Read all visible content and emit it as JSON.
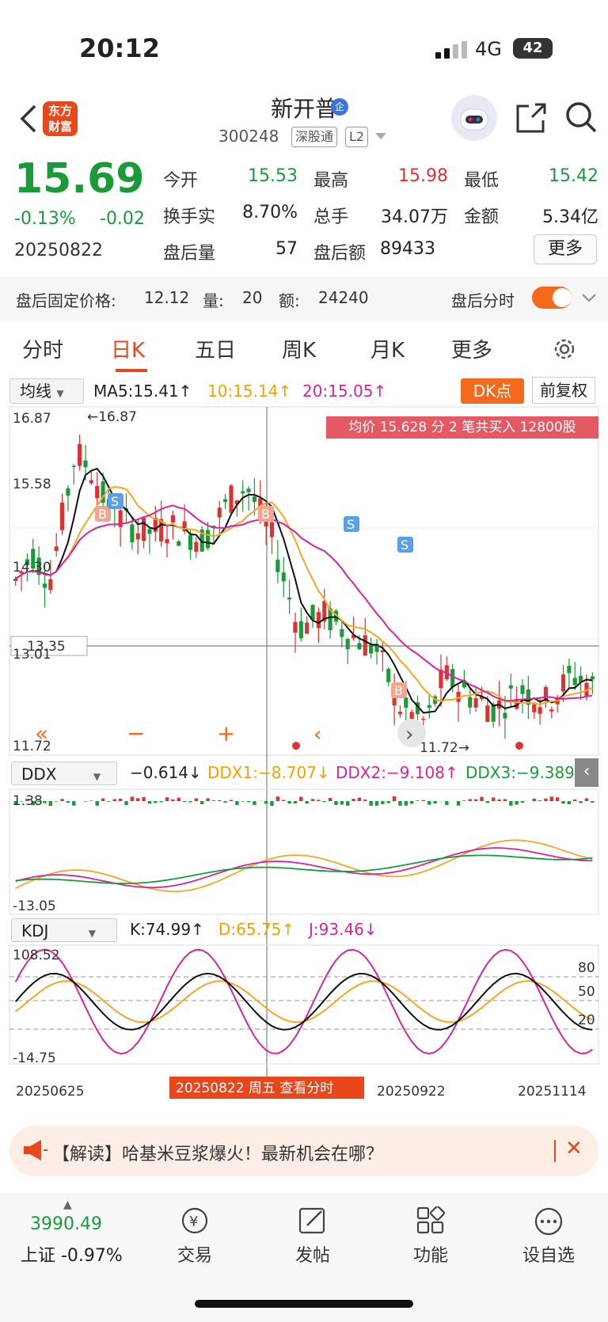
{
  "status": {
    "time": "20:12",
    "network": "4G",
    "battery": "42"
  },
  "header": {
    "logo": "东方\n财富",
    "name": "新开普",
    "badge": "企",
    "code": "300248",
    "tag1": "深股通",
    "tag2": "L2"
  },
  "quote": {
    "price": "15.69",
    "change_pct": "-0.13%",
    "change_amt": "-0.02",
    "date": "20250822",
    "open_label": "今开",
    "open": "15.53",
    "high_label": "最高",
    "high": "15.98",
    "low_label": "最低",
    "low": "15.42",
    "turnover_label": "换手实",
    "turnover": "8.70%",
    "volume_label": "总手",
    "volume": "34.07万",
    "amount_label": "金额",
    "amount": "5.34亿",
    "ah_vol_label": "盘后量",
    "ah_vol": "57",
    "ah_amt_label": "盘后额",
    "ah_amt": "89433",
    "more": "更多"
  },
  "after_hours": {
    "price_label": "盘后固定价格:",
    "price": "12.12",
    "vol_label": "量:",
    "vol": "20",
    "amt_label": "额:",
    "amt": "24240",
    "mode_label": "盘后分时"
  },
  "tabs": [
    "分时",
    "日K",
    "五日",
    "周K",
    "月K",
    "更多"
  ],
  "ma_row": {
    "select": "均线",
    "ma5": "MA5:15.41↑",
    "ma10": "10:15.14↑",
    "ma20": "20:15.05↑",
    "dk": "DK点",
    "fq": "前复权"
  },
  "tip": "均价 15.628 分 2 笔共买入 12800股",
  "kline": {
    "y_labels": [
      "16.87",
      "15.58",
      "14.30",
      "13.01",
      "11.72"
    ],
    "crosshair_price": "13.35",
    "max_label": "←16.87",
    "min_label": "11.72→"
  },
  "ddx": {
    "select": "DDX",
    "v": "−0.614↓",
    "ddx1": "DDX1:−8.707↓",
    "ddx2": "DDX2:−9.108↑",
    "ddx3": "DDX3:−9.389↑",
    "top": "1.38",
    "bottom": "-13.05"
  },
  "kdj": {
    "select": "KDJ",
    "k": "K:74.99↑",
    "d": "D:65.75↑",
    "j": "J:93.46↓",
    "top": "108.52",
    "bottom": "-14.75",
    "l80": "80",
    "l50": "50",
    "l20": "20"
  },
  "x_axis": {
    "d1": "20250625",
    "d3": "20250922",
    "d4": "20251114",
    "cross_label": "20250822 周五 查看分时"
  },
  "news": {
    "text": "【解读】哈基米豆浆爆火！最新机会在哪？"
  },
  "bottom_nav": {
    "index_value": "3990.49",
    "index_label": "上证 -0.97%",
    "trade": "交易",
    "post": "发帖",
    "func": "功能",
    "fav": "设自选"
  },
  "colors": {
    "up": "#e03131",
    "down": "#1a9b3a",
    "accent": "#f56a1a",
    "ma10": "#f5a623",
    "ma20": "#d6249f"
  }
}
